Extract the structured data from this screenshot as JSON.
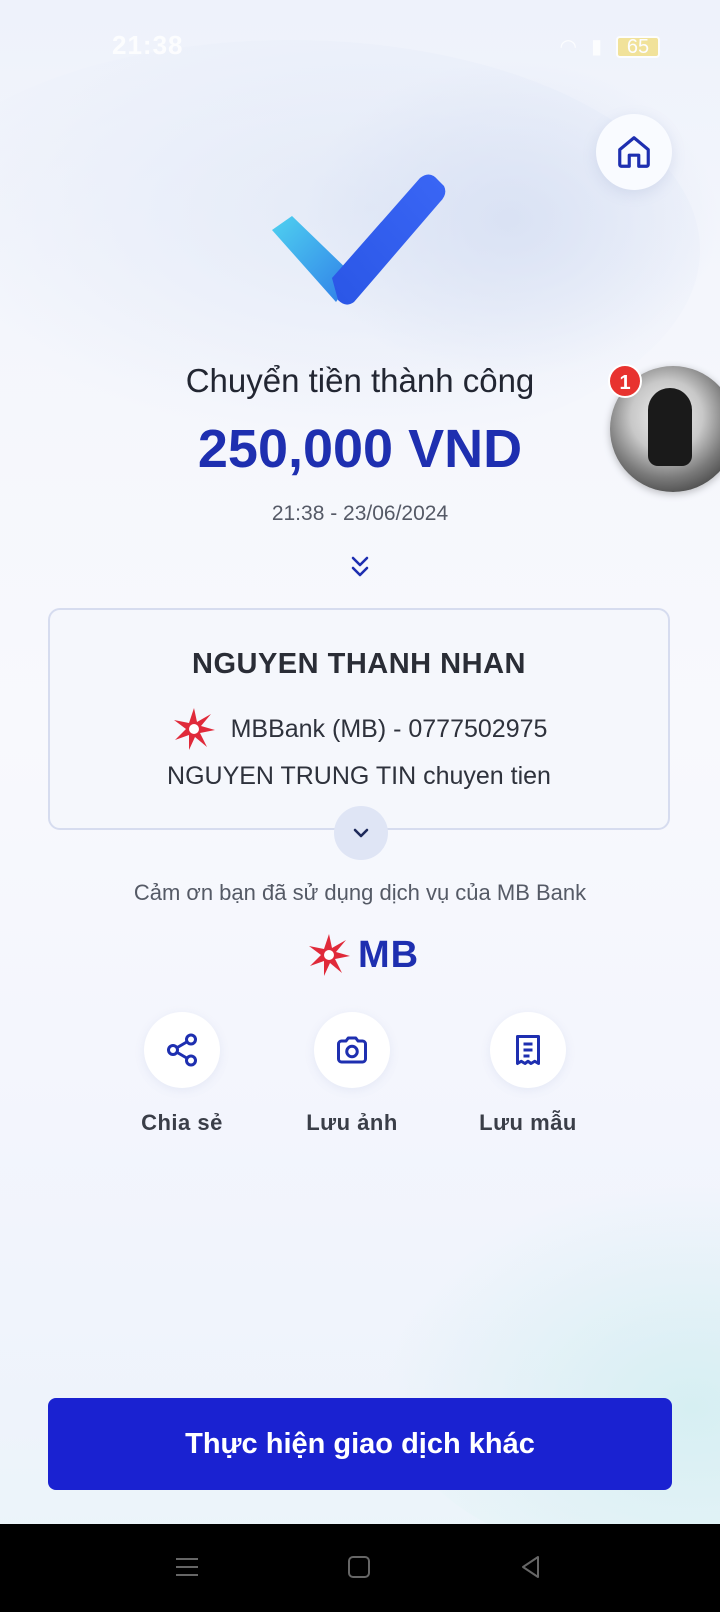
{
  "status_bar": {
    "time": "21:38",
    "battery": "65"
  },
  "result": {
    "title": "Chuyển tiền thành công",
    "amount": "250,000 VND",
    "datetime": "21:38 - 23/06/2024"
  },
  "notification": {
    "badge_count": "1"
  },
  "transfer_card": {
    "recipient_name": "NGUYEN THANH NHAN",
    "bank_account": "MBBank (MB) - 0777502975",
    "message": "NGUYEN TRUNG TIN chuyen tien"
  },
  "footer_note": "Cảm ơn bạn đã sử dụng dịch vụ của MB Bank",
  "brand": {
    "logo_text": "MB",
    "primary_color": "#1e2fb0",
    "logo_red": "#e02a3a"
  },
  "actions": [
    {
      "label": "Chia sẻ",
      "icon": "share-icon"
    },
    {
      "label": "Lưu ảnh",
      "icon": "camera-icon"
    },
    {
      "label": "Lưu mẫu",
      "icon": "receipt-icon"
    }
  ],
  "primary_button": {
    "label": "Thực hiện giao dịch khác",
    "color": "#1a22d1"
  }
}
